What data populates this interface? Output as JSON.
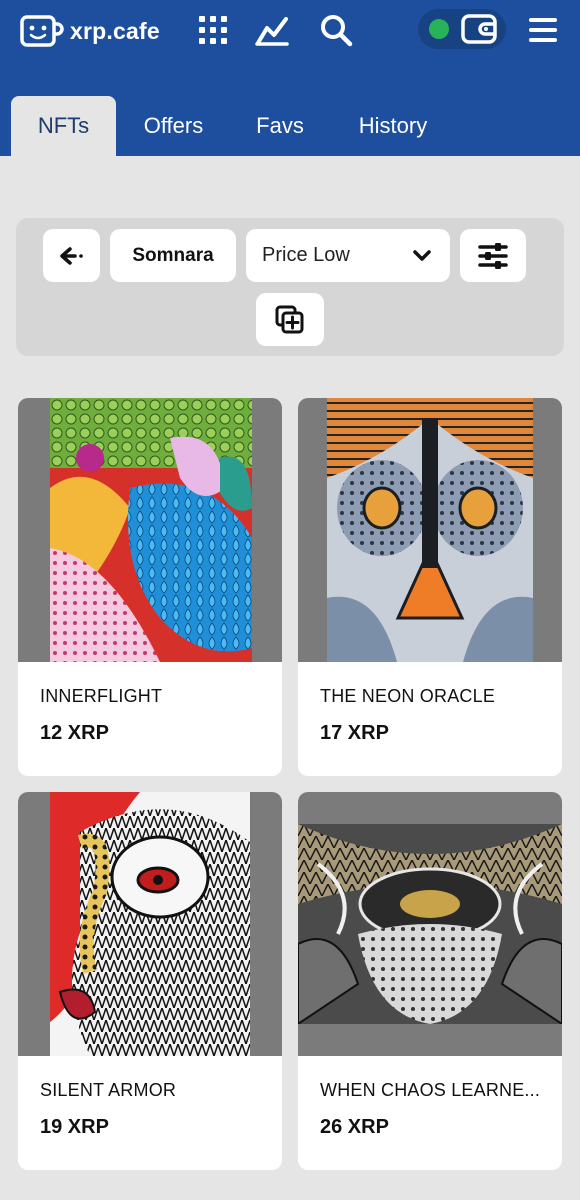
{
  "header": {
    "logo_text": "xrp.cafe",
    "icons": [
      "apps-grid-icon",
      "chart-line-icon",
      "search-icon",
      "wallet-icon",
      "hamburger-menu-icon"
    ],
    "wallet_status_color": "#27b35a",
    "brand_color": "#1d4f9e"
  },
  "tabs": [
    {
      "label": "NFTs",
      "active": true
    },
    {
      "label": "Offers",
      "active": false
    },
    {
      "label": "Favs",
      "active": false
    },
    {
      "label": "History",
      "active": false
    }
  ],
  "filters": {
    "back_icon": "arrow-left-icon",
    "collection_label": "Somnara",
    "sort_value": "Price Low",
    "settings_icon": "sliders-icon",
    "add_icon": "plus-square-icon"
  },
  "nfts": [
    {
      "name": "INNERFLIGHT",
      "price": "12 XRP"
    },
    {
      "name": "THE NEON ORACLE",
      "price": "17 XRP"
    },
    {
      "name": "SILENT ARMOR",
      "price": "19 XRP"
    },
    {
      "name": "WHEN CHAOS LEARNE...",
      "price": "26 XRP"
    }
  ]
}
